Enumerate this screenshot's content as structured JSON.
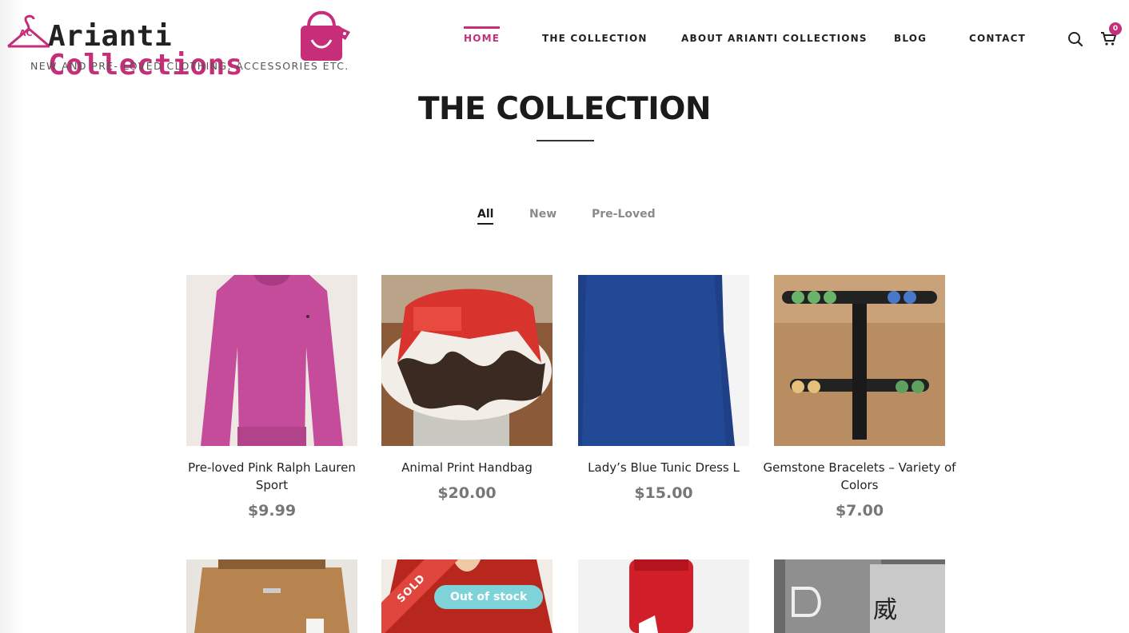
{
  "header": {
    "logo": {
      "name_part1": "Arianti",
      "name_part2": "Collections",
      "monogram": "AC",
      "tagline": "NEW AND PRE- LOVED CLOTHING, ACCESSORIES ETC."
    },
    "nav": [
      {
        "label": "HOME",
        "active": true
      },
      {
        "label": "THE COLLECTION",
        "active": false
      },
      {
        "label": "ABOUT ARIANTI COLLECTIONS",
        "active": false
      },
      {
        "label": "BLOG",
        "active": false
      },
      {
        "label": "CONTACT",
        "active": false
      }
    ],
    "search_icon": "search-icon",
    "cart_icon": "cart-icon",
    "cart_count": "0"
  },
  "page": {
    "title": "THE COLLECTION"
  },
  "filters": [
    {
      "label": "All",
      "active": true
    },
    {
      "label": "New",
      "active": false
    },
    {
      "label": "Pre-Loved",
      "active": false
    }
  ],
  "products": [
    {
      "name": "Pre-loved Pink Ralph Lauren Sport",
      "price": "$9.99"
    },
    {
      "name": "Animal Print Handbag",
      "price": "$20.00"
    },
    {
      "name": "Lady’s Blue Tunic Dress L",
      "price": "$15.00"
    },
    {
      "name": "Gemstone Bracelets – Variety of Colors",
      "price": "$7.00"
    },
    {
      "name": "",
      "price": ""
    },
    {
      "name": "",
      "price": "",
      "ribbon": "SOLD",
      "badge": "Out of stock"
    },
    {
      "name": "",
      "price": ""
    },
    {
      "name": "",
      "price": "",
      "glyph": "威"
    }
  ],
  "colors": {
    "brand": "#c62e7a",
    "sold": "#e0463d",
    "out_of_stock": "#7dd3d8"
  }
}
